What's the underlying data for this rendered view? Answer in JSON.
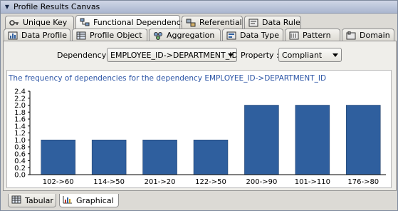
{
  "window": {
    "title": "Profile Results Canvas"
  },
  "tabs_row1": [
    {
      "label": "Unique Key",
      "icon": "key-icon"
    },
    {
      "label": "Functional Dependency",
      "icon": "dependency-icon",
      "selected": true
    },
    {
      "label": "Referential",
      "icon": "referential-icon"
    },
    {
      "label": "Data Rule",
      "icon": "data-rule-icon"
    }
  ],
  "tabs_row2": [
    {
      "label": "Data Profile",
      "icon": "data-profile-icon"
    },
    {
      "label": "Profile Object",
      "icon": "profile-object-icon"
    },
    {
      "label": "Aggregation",
      "icon": "aggregation-icon"
    },
    {
      "label": "Data Type",
      "icon": "data-type-icon"
    },
    {
      "label": "Pattern",
      "icon": "pattern-icon"
    },
    {
      "label": "Domain",
      "icon": "domain-icon"
    }
  ],
  "filters": {
    "dependency_label": "Dependency :",
    "dependency_value": "EMPLOYEE_ID->DEPARTMENT_ID",
    "property_label": "Property :",
    "property_value": "Compliant"
  },
  "bottom_tabs": [
    {
      "label": "Tabular",
      "icon": "table-icon"
    },
    {
      "label": "Graphical",
      "icon": "bar-chart-icon",
      "selected": true
    }
  ],
  "colors": {
    "bar": "#2f5f9e",
    "title_text": "#2c55a6"
  },
  "chart_data": {
    "type": "bar",
    "title": "The frequency of dependencies for the dependency EMPLOYEE_ID->DEPARTMENT_ID",
    "categories": [
      "102->60",
      "114->50",
      "201->20",
      "122->50",
      "200->90",
      "101->110",
      "176->80"
    ],
    "values": [
      1.0,
      1.0,
      1.0,
      1.0,
      2.0,
      2.0,
      2.0
    ],
    "ylim": [
      0,
      2.4
    ],
    "yticks": [
      "0.0",
      "0.2",
      "0.4",
      "0.6",
      "0.8",
      "1.0",
      "1.2",
      "1.4",
      "1.6",
      "1.8",
      "2.0",
      "2.2",
      "2.4"
    ],
    "xlabel": "",
    "ylabel": "",
    "grid": false
  }
}
